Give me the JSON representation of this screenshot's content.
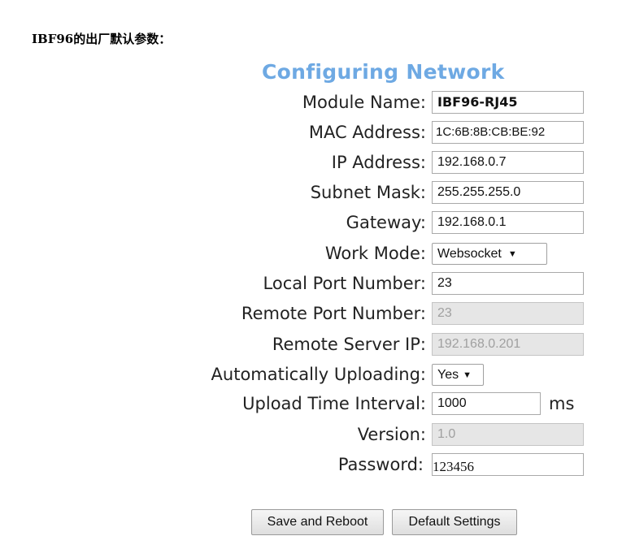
{
  "doc_heading": "IBF96的出厂默认参数：",
  "form": {
    "title": "Configuring Network",
    "module_name": {
      "label": "Module Name:",
      "value": "IBF96-RJ45"
    },
    "mac_address": {
      "label": "MAC Address:",
      "value": "1C:6B:8B:CB:BE:92"
    },
    "ip_address": {
      "label": "IP Address:",
      "value": "192.168.0.7"
    },
    "subnet_mask": {
      "label": "Subnet Mask:",
      "value": "255.255.255.0"
    },
    "gateway": {
      "label": "Gateway:",
      "value": "192.168.0.1"
    },
    "work_mode": {
      "label": "Work Mode:",
      "value": "Websocket",
      "caret": "▼"
    },
    "local_port": {
      "label": "Local Port Number:",
      "value": "23"
    },
    "remote_port": {
      "label": "Remote Port Number:",
      "value": "23",
      "disabled": true
    },
    "remote_server_ip": {
      "label": "Remote Server IP:",
      "value": "192.168.0.201",
      "disabled": true
    },
    "auto_upload": {
      "label": "Automatically Uploading:",
      "value": "Yes",
      "caret": "▼"
    },
    "upload_interval": {
      "label": "Upload Time Interval:",
      "value": "1000",
      "unit": "ms"
    },
    "version": {
      "label": "Version:",
      "value": "1.0",
      "disabled": true
    },
    "password": {
      "label": "Password:",
      "value": "123456"
    }
  },
  "buttons": {
    "save_reboot": "Save and Reboot",
    "default_settings": "Default Settings"
  },
  "colors": {
    "title": "#6ea9e3",
    "disabled_bg": "#e6e6e6"
  }
}
